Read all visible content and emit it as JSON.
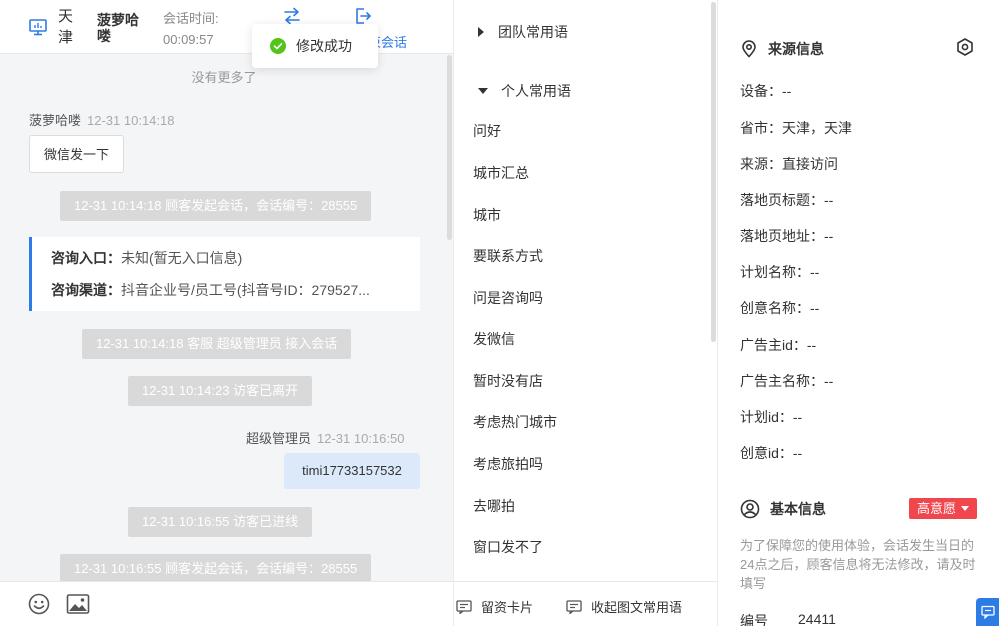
{
  "header": {
    "city": "天津",
    "visitor_name": "菠萝哈喽",
    "session_time_label": "会话时间:",
    "session_time_value": "00:09:57",
    "end_session_label": "束会话"
  },
  "toast": {
    "text": "修改成功"
  },
  "chat": {
    "no_more": "没有更多了",
    "visitor_meta": {
      "name": "菠萝哈喽",
      "time": "12-31 10:14:18"
    },
    "visitor_message": "微信发一下",
    "sys_1": "12-31 10:14:18 顾客发起会话，会话编号：28555",
    "info_card": {
      "entry_label": "咨询入口：",
      "entry_value": "未知(暂无入口信息)",
      "channel_label": "咨询渠道：",
      "channel_value": "抖音企业号/员工号(抖音号ID：279527..."
    },
    "sys_2": "12-31 10:14:18 客服 超级管理员 接入会话",
    "sys_3": "12-31 10:14:23 访客已离开",
    "agent_meta": {
      "name": "超级管理员",
      "time": "12-31 10:16:50"
    },
    "agent_message": "timi17733157532",
    "sys_4": "12-31 10:16:55 访客已进线",
    "sys_5": "12-31 10:16:55 顾客发起会话，会话编号：28555"
  },
  "phrases": {
    "team_group": "团队常用语",
    "personal_group": "个人常用语",
    "items": [
      "问好",
      "城市汇总",
      "城市",
      "要联系方式",
      "问是咨询吗",
      "发微信",
      "暂时没有店",
      "考虑热门城市",
      "考虑旅拍吗",
      "去哪拍",
      "窗口发不了"
    ],
    "footer": {
      "card_label": "留资卡片",
      "collapse_label": "收起图文常用语"
    }
  },
  "info": {
    "source_title": "来源信息",
    "fields": [
      "设备：--",
      "省市：天津，天津",
      "来源：直接访问",
      "落地页标题：--",
      "落地页地址：--",
      "计划名称：--",
      "创意名称：--",
      "广告主id：--",
      "广告主名称：--",
      "计划id：--",
      "创意id：--"
    ],
    "basic_title": "基本信息",
    "intent_badge": "高意愿",
    "notice": "为了保障您的使用体验，会话发生当日的24点之后，顾客信息将无法修改，请及时填写",
    "id_label": "编号",
    "id_value": "24411"
  },
  "colors": {
    "accent": "#2d7be5",
    "success": "#52c41a",
    "danger": "#f0464e",
    "system_msg_bg": "#d9d9d9",
    "agent_bubble": "#dce9fb"
  },
  "icons": [
    "monitor-icon",
    "transfer-icon",
    "exit-icon",
    "check-circle-icon",
    "emoji-icon",
    "image-icon",
    "location-icon",
    "settings-icon",
    "user-circle-icon",
    "message-icon",
    "card-icon"
  ]
}
